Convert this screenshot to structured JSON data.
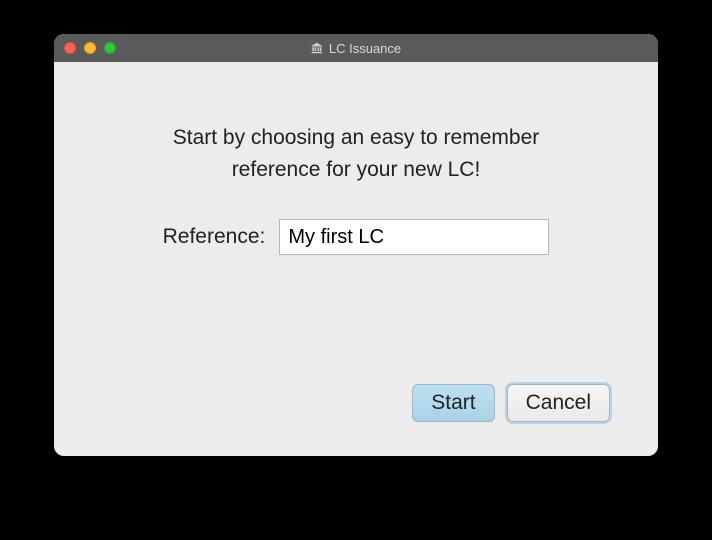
{
  "window": {
    "title": "LC Issuance"
  },
  "content": {
    "instruction_line1": "Start by choosing an easy to remember",
    "instruction_line2": "reference for your new LC!",
    "reference_label": "Reference:",
    "reference_value": "My first LC"
  },
  "buttons": {
    "start": "Start",
    "cancel": "Cancel"
  }
}
